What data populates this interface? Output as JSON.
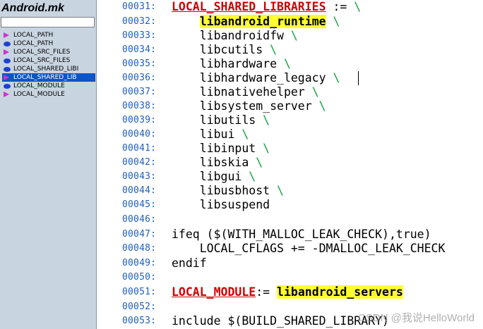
{
  "sidebar": {
    "title": "Android.mk",
    "search_value": "",
    "symbols": [
      {
        "icon": "macro-triangle-icon",
        "label": "LOCAL_PATH",
        "selected": false
      },
      {
        "icon": "variable-ellipse-icon",
        "label": "LOCAL_PATH",
        "selected": false
      },
      {
        "icon": "macro-triangle-icon",
        "label": "LOCAL_SRC_FILES",
        "selected": false
      },
      {
        "icon": "variable-ellipse-icon",
        "label": "LOCAL_SRC_FILES",
        "selected": false
      },
      {
        "icon": "variable-ellipse-icon",
        "label": "LOCAL_SHARED_LIBI",
        "selected": false
      },
      {
        "icon": "macro-triangle-icon",
        "label": "LOCAL_SHARED_LIB",
        "selected": true
      },
      {
        "icon": "variable-ellipse-icon",
        "label": "LOCAL_MODULE",
        "selected": false
      },
      {
        "icon": "macro-triangle-icon",
        "label": "LOCAL_MODULE",
        "selected": false
      }
    ]
  },
  "editor": {
    "lines": [
      {
        "num": "00031:",
        "pre": "",
        "kw": "LOCAL_SHARED_LIBRARIES",
        "mid": " := ",
        "hl": "",
        "bs": "\\"
      },
      {
        "num": "00032:",
        "pre": "    ",
        "kw": "",
        "mid": "",
        "hl": "libandroid_runtime",
        "bs": " \\"
      },
      {
        "num": "00033:",
        "pre": "    libandroidfw ",
        "kw": "",
        "mid": "",
        "hl": "",
        "bs": "\\"
      },
      {
        "num": "00034:",
        "pre": "    libcutils ",
        "kw": "",
        "mid": "",
        "hl": "",
        "bs": "\\"
      },
      {
        "num": "00035:",
        "pre": "    libhardware ",
        "kw": "",
        "mid": "",
        "hl": "",
        "bs": "\\"
      },
      {
        "num": "00036:",
        "pre": "    libhardware_legacy ",
        "kw": "",
        "mid": "",
        "hl": "",
        "bs": "\\"
      },
      {
        "num": "00037:",
        "pre": "    libnativehelper ",
        "kw": "",
        "mid": "",
        "hl": "",
        "bs": "\\"
      },
      {
        "num": "00038:",
        "pre": "    libsystem_server ",
        "kw": "",
        "mid": "",
        "hl": "",
        "bs": "\\"
      },
      {
        "num": "00039:",
        "pre": "    libutils ",
        "kw": "",
        "mid": "",
        "hl": "",
        "bs": "\\"
      },
      {
        "num": "00040:",
        "pre": "    libui ",
        "kw": "",
        "mid": "",
        "hl": "",
        "bs": "\\"
      },
      {
        "num": "00041:",
        "pre": "    libinput ",
        "kw": "",
        "mid": "",
        "hl": "",
        "bs": "\\"
      },
      {
        "num": "00042:",
        "pre": "    libskia ",
        "kw": "",
        "mid": "",
        "hl": "",
        "bs": "\\"
      },
      {
        "num": "00043:",
        "pre": "    libgui ",
        "kw": "",
        "mid": "",
        "hl": "",
        "bs": "\\"
      },
      {
        "num": "00044:",
        "pre": "    libusbhost ",
        "kw": "",
        "mid": "",
        "hl": "",
        "bs": "\\"
      },
      {
        "num": "00045:",
        "pre": "    libsuspend",
        "kw": "",
        "mid": "",
        "hl": "",
        "bs": ""
      },
      {
        "num": "00046:",
        "pre": "",
        "kw": "",
        "mid": "",
        "hl": "",
        "bs": ""
      },
      {
        "num": "00047:",
        "pre": "ifeq ($(WITH_MALLOC_LEAK_CHECK),true)",
        "kw": "",
        "mid": "",
        "hl": "",
        "bs": ""
      },
      {
        "num": "00048:",
        "pre": "    LOCAL_CFLAGS += -DMALLOC_LEAK_CHECK",
        "kw": "",
        "mid": "",
        "hl": "",
        "bs": ""
      },
      {
        "num": "00049:",
        "pre": "endif",
        "kw": "",
        "mid": "",
        "hl": "",
        "bs": ""
      },
      {
        "num": "00050:",
        "pre": "",
        "kw": "",
        "mid": "",
        "hl": "",
        "bs": ""
      },
      {
        "num": "00051:",
        "pre": "",
        "kw": "LOCAL_MODULE",
        "mid": ":= ",
        "hl": "libandroid_servers",
        "bs": ""
      },
      {
        "num": "00052:",
        "pre": "",
        "kw": "",
        "mid": "",
        "hl": "",
        "bs": ""
      },
      {
        "num": "00053:",
        "pre": "include $(BUILD_SHARED_LIBRARY)",
        "kw": "",
        "mid": "",
        "hl": "",
        "bs": ""
      }
    ]
  },
  "watermark": "CSDN @我说HelloWorld",
  "colors": {
    "keyword": "#d00000",
    "highlight": "#ffff30",
    "line_number": "#2060c0",
    "continuation": "#12a040",
    "selection": "#0a55c8"
  }
}
